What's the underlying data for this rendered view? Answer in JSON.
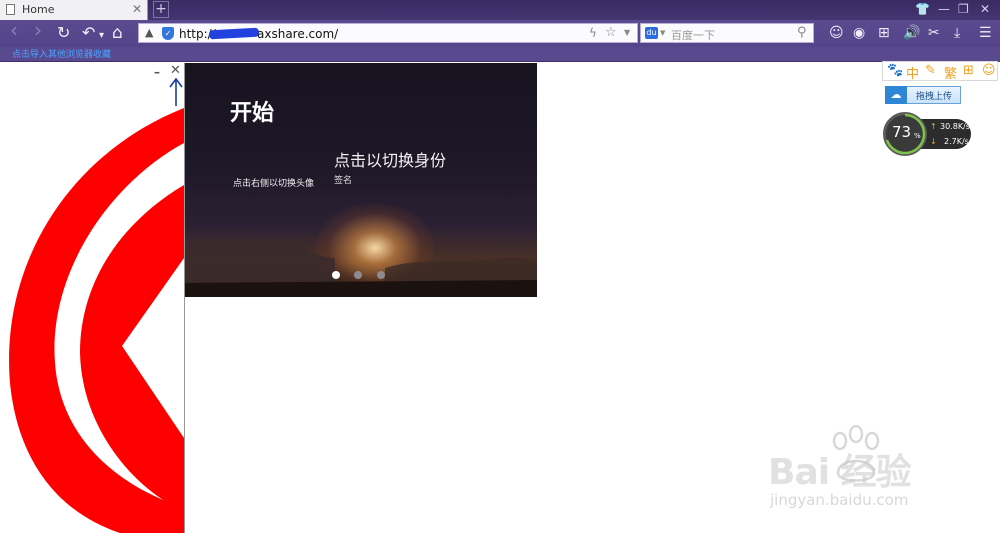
{
  "browser": {
    "tab": {
      "title": "Home",
      "close_icon": "✕"
    },
    "new_tab": "+",
    "window_controls": {
      "skin": "👕",
      "minimize": "—",
      "restore": "❐",
      "close": "✕"
    },
    "nav": {
      "back": "‹",
      "forward": "›",
      "reload": "↻",
      "undo": "↶",
      "undo_dropdown": "▾",
      "home": "⌂"
    },
    "address": {
      "url_prefix": "http://",
      "url_rest": "axshare.com/",
      "bolt": "ϟ",
      "star": "☆",
      "dropdown": "▼"
    },
    "search": {
      "engine_glyph": "du",
      "engine_arrow": "▼",
      "placeholder": "百度一下",
      "magnifier": "⚲"
    },
    "toolbar": {
      "chat": "☺",
      "screenshot": "◉",
      "apps": "⊞",
      "sound": "🔊",
      "cut": "✂",
      "download": "⤓",
      "menu": "☰"
    },
    "bookmark_bar_text": "点击导入其他浏览器收藏"
  },
  "panel": {
    "minimize": "–",
    "close": "✕"
  },
  "hero": {
    "title": "开始",
    "avatar_hint": "点击右侧以切换头像",
    "switch_identity": "点击以切换身份",
    "signature": "签名",
    "carousel": {
      "count": 3,
      "active_index": 0
    }
  },
  "extensions": {
    "toolbar_icons": [
      "🐾",
      "中",
      "✎",
      "繁",
      "⊞",
      "☺"
    ],
    "upload_label": "拖拽上传",
    "cloud_glyph": "☁",
    "speed": {
      "percent": "73",
      "percent_sign": "%",
      "up": "30.8K/s",
      "down": "2.7K/s",
      "up_arrow": "↑",
      "down_arrow": "↓"
    }
  },
  "watermark": {
    "brand": "Bai  经验",
    "url": "jingyan.baidu.com"
  },
  "colors": {
    "chrome": "#54448a",
    "logo_red": "#ff0000",
    "link_blue": "#49a4ff"
  }
}
